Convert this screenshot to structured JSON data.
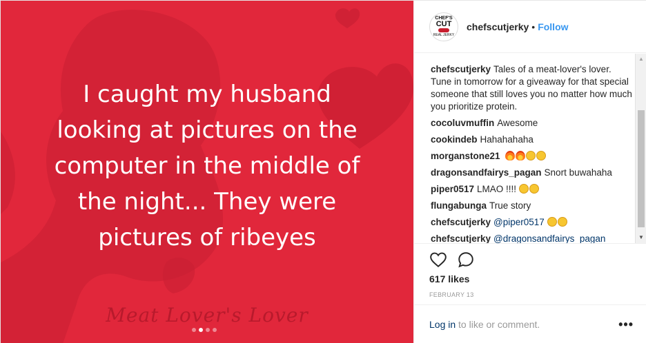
{
  "media": {
    "quote_lines": [
      "I caught my husband",
      "looking at pictures on the",
      "computer in the middle of",
      "the night... They were",
      "pictures of ribeyes"
    ],
    "signature": "Meat Lover's Lover",
    "background_color": "#e1273b",
    "carousel_dots": 4,
    "carousel_active_index": 1
  },
  "header": {
    "avatar_text": {
      "line1": "CHEF'S",
      "line2": "CUT",
      "line3": "REAL JERKY"
    },
    "username": "chefscutjerky",
    "separator": "•",
    "follow_label": "Follow"
  },
  "comments": [
    {
      "user": "chefscutjerky",
      "text": "Tales of a meat-lover's lover. Tune in tomorrow for a giveaway for that special someone that still loves you no matter how much you prioritize protein."
    },
    {
      "user": "cocoluvmuffin",
      "text": "Awesome"
    },
    {
      "user": "cookindeb",
      "text": "Hahahahaha"
    },
    {
      "user": "morganstone21",
      "text": "",
      "emojis": [
        "fire",
        "fire",
        "grin",
        "grin"
      ]
    },
    {
      "user": "dragonsandfairys_pagan",
      "text": "Snort buwahaha"
    },
    {
      "user": "piper0517",
      "text": "LMAO !!!!",
      "emojis": [
        "rofl",
        "rofl"
      ]
    },
    {
      "user": "flungabunga",
      "text": "True story"
    },
    {
      "user": "chefscutjerky",
      "mention": "@piper0517",
      "emojis": [
        "grin",
        "tired"
      ]
    },
    {
      "user": "chefscutjerky",
      "mention": "@dragonsandfairys_pagan"
    }
  ],
  "actions": {
    "like_icon": "heart-icon",
    "comment_icon": "comment-icon"
  },
  "likes": "617 likes",
  "date": "FEBRUARY 13",
  "footer": {
    "login_label": "Log in",
    "rest_text": " to like or comment.",
    "more_icon": "more-icon"
  },
  "colors": {
    "link": "#3897f0",
    "mention": "#003569",
    "muted": "#999999"
  }
}
